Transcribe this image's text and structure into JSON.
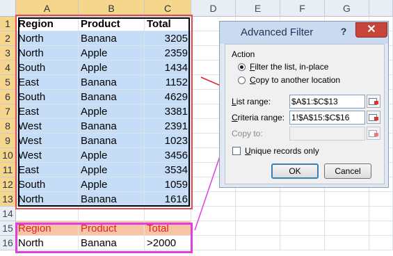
{
  "columns": [
    "A",
    "B",
    "C",
    "D",
    "E",
    "F",
    "G"
  ],
  "rows": [
    "1",
    "2",
    "3",
    "4",
    "5",
    "6",
    "7",
    "8",
    "9",
    "10",
    "11",
    "12",
    "13",
    "14",
    "15",
    "16"
  ],
  "table_header": [
    "Region",
    "Product",
    "Total"
  ],
  "table_rows": [
    [
      "North",
      "Banana",
      "3205"
    ],
    [
      "North",
      "Apple",
      "2359"
    ],
    [
      "South",
      "Apple",
      "1434"
    ],
    [
      "East",
      "Banana",
      "1152"
    ],
    [
      "South",
      "Banana",
      "4629"
    ],
    [
      "East",
      "Apple",
      "3381"
    ],
    [
      "West",
      "Banana",
      "2391"
    ],
    [
      "West",
      "Banana",
      "1023"
    ],
    [
      "West",
      "Apple",
      "3456"
    ],
    [
      "East",
      "Apple",
      "3534"
    ],
    [
      "South",
      "Apple",
      "1059"
    ],
    [
      "North",
      "Banana",
      "1616"
    ]
  ],
  "criteria_header": [
    "Region",
    "Product",
    "Total"
  ],
  "criteria_row": [
    "North",
    "Banana",
    ">2000"
  ],
  "dialog": {
    "title": "Advanced Filter",
    "help": "?",
    "close": "✕",
    "action_label": "Action",
    "radio_filter_in_place": "Filter the list, in-place",
    "radio_copy": "Copy to another location",
    "list_range_label": "List range:",
    "list_range_value": "$A$1:$C$13",
    "criteria_range_label": "Criteria range:",
    "criteria_range_value": "1!$A$15:$C$16",
    "copy_to_label": "Copy to:",
    "unique_label": "Unique records only",
    "ok": "OK",
    "cancel": "Cancel"
  },
  "colors": {
    "selection": "#c5ddf7",
    "highlight_box": "#e64b4b",
    "criteria_box": "#df3fde",
    "criteria_header_text": "#e0231b"
  }
}
